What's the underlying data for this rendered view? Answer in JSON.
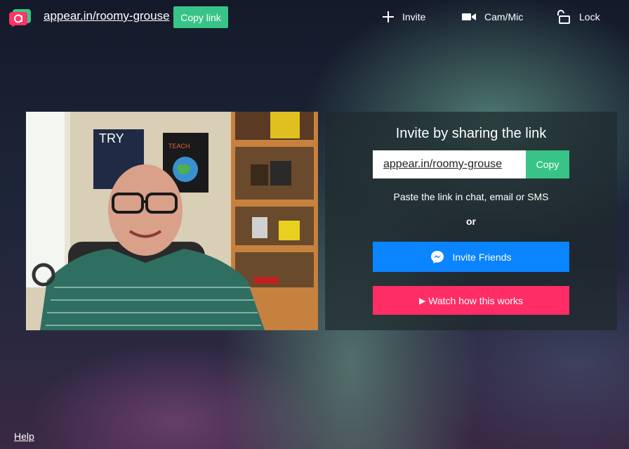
{
  "header": {
    "room_link": "appear.in/roomy-grouse",
    "copy_link_label": "Copy link",
    "nav": {
      "invite": "Invite",
      "cam_mic": "Cam/Mic",
      "lock": "Lock"
    },
    "icons": [
      "appear-in-logo-icon",
      "plus-icon",
      "camera-icon",
      "unlock-icon"
    ]
  },
  "video": {
    "poster_text": "TRY",
    "poster2_text": "TEACH"
  },
  "invite_panel": {
    "title": "Invite by sharing the link",
    "link_value": "appear.in/roomy-grouse",
    "copy_label": "Copy",
    "paste_hint": "Paste the link in chat, email or SMS",
    "or_label": "or",
    "invite_friends_label": "Invite Friends",
    "watch_label": "Watch how this works",
    "watch_icon": "play-icon",
    "messenger_icon": "messenger-icon"
  },
  "footer": {
    "help_label": "Help"
  },
  "colors": {
    "green": "#38c487",
    "messenger_blue": "#0a84ff",
    "watch_pink": "#ff2d65",
    "logo_red": "#ff3366"
  }
}
